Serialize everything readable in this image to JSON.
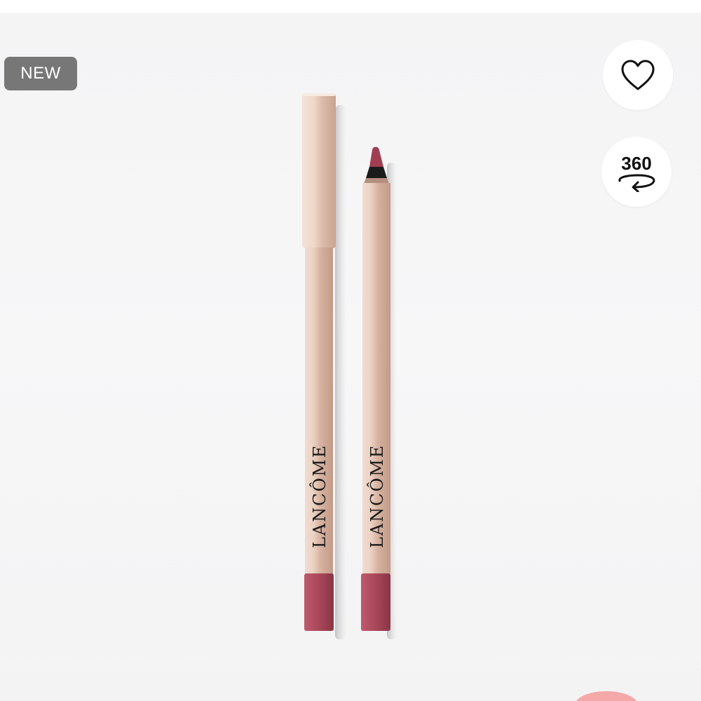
{
  "badge": {
    "label": "NEW",
    "color": "#777777"
  },
  "actions": {
    "favorite_icon": "heart-outline-icon",
    "rotate_label": "360",
    "rotate_icon": "rotate-arrow-icon"
  },
  "product": {
    "brand": "LANCÔME",
    "pencils": [
      {
        "state": "capped"
      },
      {
        "state": "uncapped"
      }
    ],
    "colors": {
      "barrel": "#e2c2b0",
      "tip": "#a9475a",
      "lead": "#8c2f42"
    }
  }
}
